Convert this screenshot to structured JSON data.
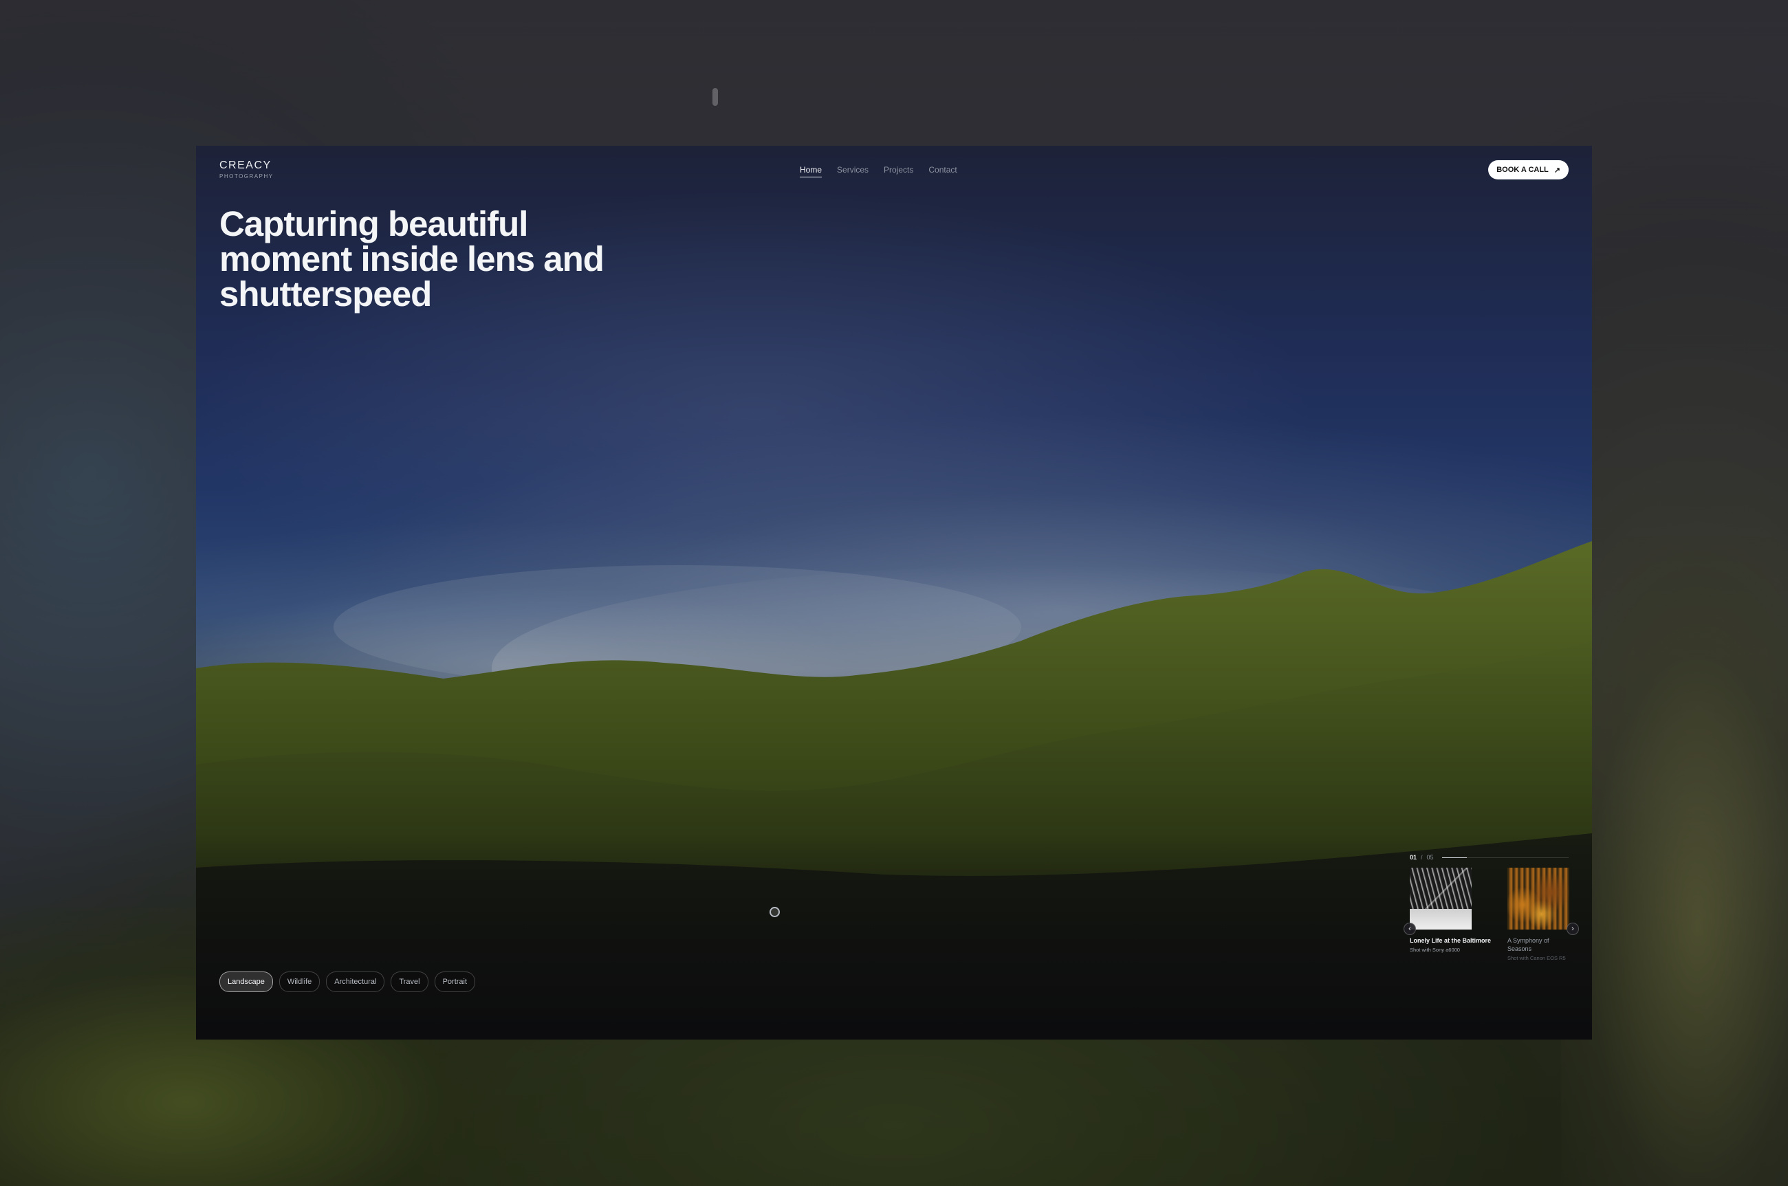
{
  "brand": {
    "name": "CREACY",
    "tagline": "PHOTOGRAPHY"
  },
  "nav": {
    "items": [
      {
        "label": "Home",
        "active": true
      },
      {
        "label": "Services",
        "active": false
      },
      {
        "label": "Projects",
        "active": false
      },
      {
        "label": "Contact",
        "active": false
      }
    ],
    "cta_label": "BOOK A CALL",
    "cta_icon": "arrow-up-right-icon"
  },
  "hero": {
    "title": "Capturing beautiful moment inside lens and shutterspeed"
  },
  "categories": [
    {
      "label": "Landscape",
      "active": true
    },
    {
      "label": "Wildlife",
      "active": false
    },
    {
      "label": "Architectural",
      "active": false
    },
    {
      "label": "Travel",
      "active": false
    },
    {
      "label": "Portrait",
      "active": false
    }
  ],
  "slider": {
    "current": "01",
    "separator": "/",
    "total": "05",
    "progress": 0.2,
    "prev_icon": "chevron-left-icon",
    "next_icon": "chevron-right-icon",
    "cards": [
      {
        "title": "Lonely Life at the Baltimore",
        "subtitle": "Shot with Sony a6000"
      },
      {
        "title": "A Symphony of Seasons",
        "subtitle": "Shot with Canon EOS R5"
      }
    ]
  },
  "colors": {
    "accent": "#ffffff",
    "text_primary": "#f4f5f7",
    "text_muted": "#8d93a0"
  }
}
